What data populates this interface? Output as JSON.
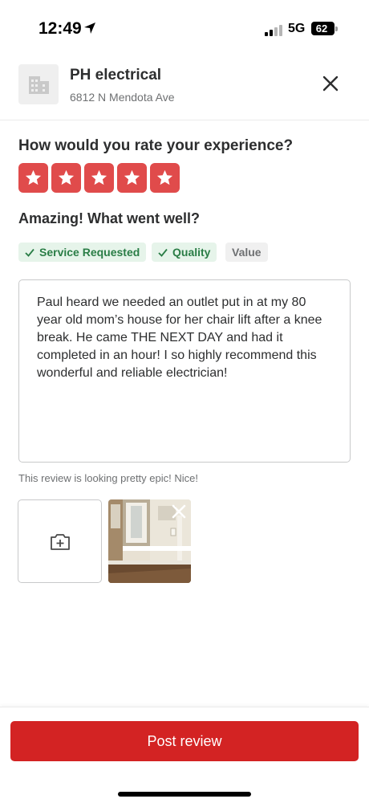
{
  "status_bar": {
    "time": "12:49",
    "network": "5G",
    "battery": "62",
    "battery_level": 0.62,
    "icons": [
      "location-arrow-icon",
      "signal-icon",
      "battery-icon"
    ]
  },
  "business": {
    "name": "PH electrical",
    "address": "6812 N Mendota Ave",
    "icons": [
      "building-icon",
      "close-icon"
    ]
  },
  "rating": {
    "question": "How would you rate your experience?",
    "stars": 5,
    "max_stars": 5,
    "star_color": "#e04b4b",
    "headline": "Amazing! What went well?"
  },
  "chips": [
    {
      "label": "Service Requested",
      "selected": true
    },
    {
      "label": "Quality",
      "selected": true
    },
    {
      "label": "Value",
      "selected": false
    }
  ],
  "review": {
    "text": "Paul heard we needed an outlet put in at my 80 year old mom’s house for her chair lift after a knee break.  He came THE NEXT DAY and had it completed in an hour!  I so highly recommend this wonderful and reliable electrician!",
    "hint": "This review is looking pretty epic! Nice!"
  },
  "photos": {
    "icons": [
      "add-photo-icon",
      "remove-photo-icon"
    ]
  },
  "footer": {
    "post_label": "Post review",
    "button_color": "#d32323"
  }
}
